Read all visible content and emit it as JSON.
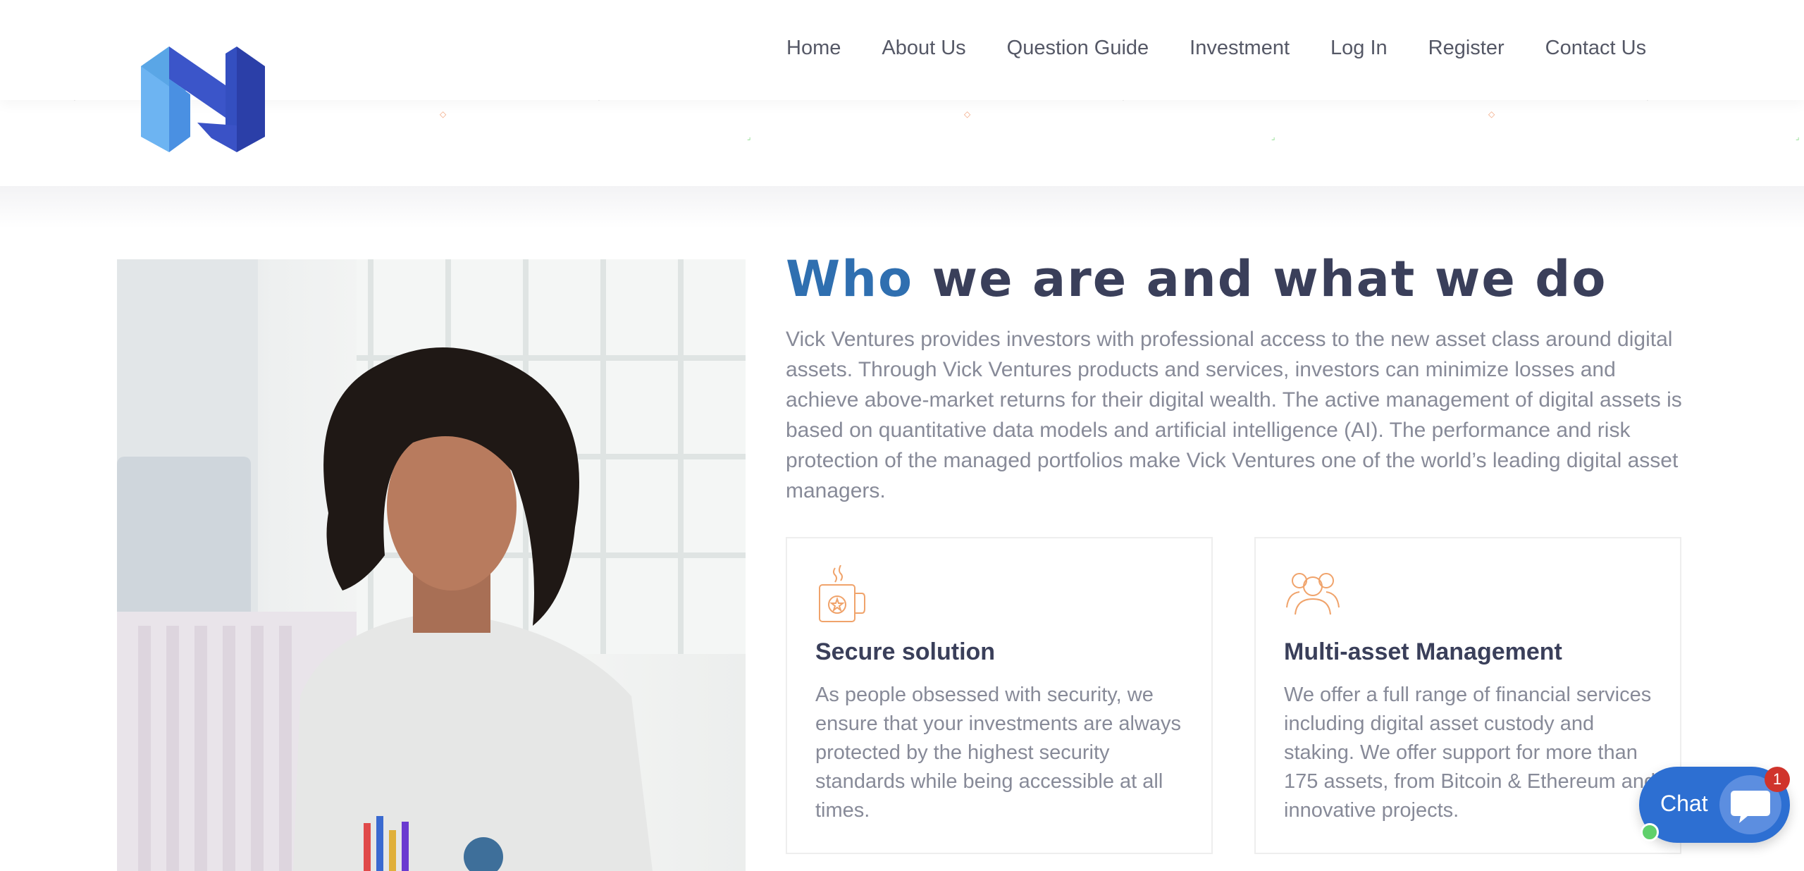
{
  "brand": {
    "logo_icon": "n-cube-logo-icon",
    "colors": {
      "light_blue": "#6db4f2",
      "mid_blue": "#4a90e2",
      "dark_blue": "#2f4fc4"
    }
  },
  "nav": {
    "items": [
      {
        "label": "Home"
      },
      {
        "label": "About Us"
      },
      {
        "label": "Question Guide"
      },
      {
        "label": "Investment"
      },
      {
        "label": "Log In"
      },
      {
        "label": "Register"
      },
      {
        "label": "Contact Us"
      }
    ]
  },
  "about": {
    "title_accent": "Who",
    "title_rest": " we are and what we do",
    "accent_color": "#2f6fb0",
    "paragraph": "Vick Ventures provides investors with professional access to the new asset class around digital assets. Through Vick Ventures products and services, investors can minimize losses and achieve above-market returns for their digital wealth. The active management of digital assets is based on quantitative data models and artificial intelligence (AI). The performance and risk protection of the managed portfolios make Vick Ventures one of the world’s leading digital asset managers."
  },
  "image": {
    "subject": "woman-at-desk-photo"
  },
  "features": [
    {
      "icon": "mug-icon",
      "title": "Secure solution",
      "text": "As people obsessed with security, we ensure that your investments are always protected by the highest security standards while being accessible at all times."
    },
    {
      "icon": "users-group-icon",
      "title": "Multi-asset Management",
      "text": "We offer a full range of financial services including digital asset custody and staking. We offer support for more than 175 assets, from Bitcoin & Ethereum and innovative projects."
    }
  ],
  "chat": {
    "label": "Chat",
    "badge": "1",
    "icon": "chat-bubble-icon",
    "color": "#2d6fd2"
  }
}
